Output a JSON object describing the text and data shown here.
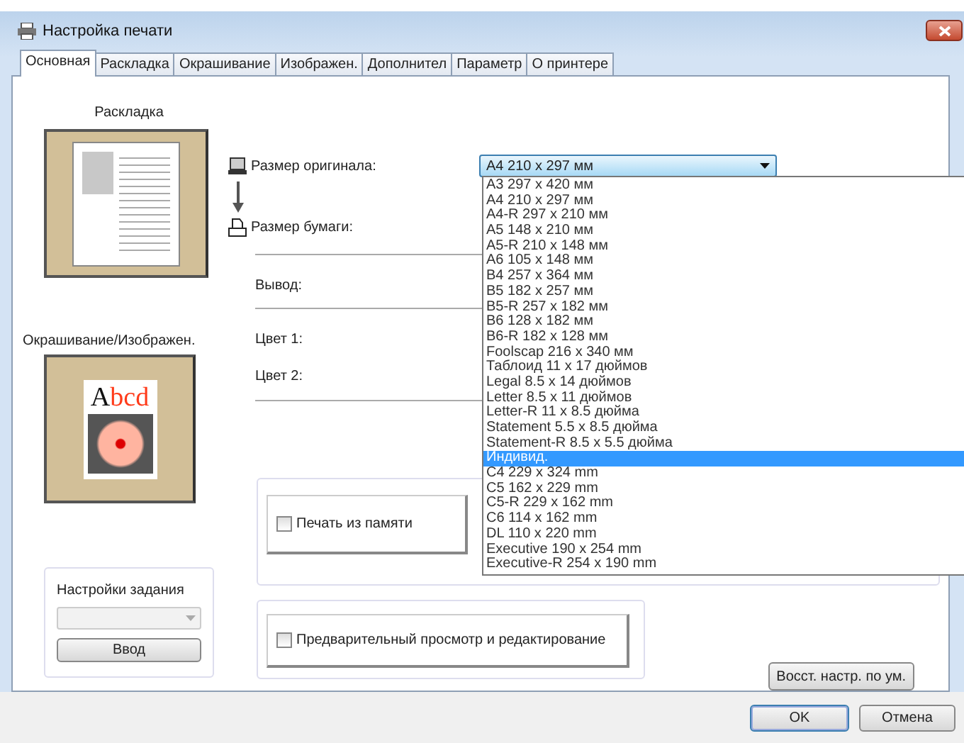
{
  "window": {
    "title": "Настройка печати"
  },
  "tabs": [
    {
      "label": "Основная",
      "selected": true
    },
    {
      "label": "Раскладка",
      "selected": false
    },
    {
      "label": "Окрашивание",
      "selected": false
    },
    {
      "label": "Изображен.",
      "selected": false
    },
    {
      "label": "Дополнител",
      "selected": false
    },
    {
      "label": "Параметр",
      "selected": false
    },
    {
      "label": "О принтере",
      "selected": false
    }
  ],
  "left_panel": {
    "layout_label": "Раскладка",
    "color_label": "Окрашивание/Изображен.",
    "sample_text": "Abcd",
    "job_settings": {
      "title": "Настройки задания",
      "button": "Ввод"
    }
  },
  "settings": {
    "original_size_label": "Размер оригинала:",
    "original_size_value": "A4 210 x 297 мм",
    "paper_size_label": "Размер бумаги:",
    "output_label": "Вывод:",
    "color1_label": "Цвет 1:",
    "color2_label": "Цвет 2:"
  },
  "size_options": [
    {
      "label": "A3 297 x 420 мм",
      "selected": false
    },
    {
      "label": "A4 210 x 297 мм",
      "selected": false
    },
    {
      "label": "A4-R 297 x 210 мм",
      "selected": false
    },
    {
      "label": "A5 148 x 210 мм",
      "selected": false
    },
    {
      "label": "A5-R 210 x 148 мм",
      "selected": false
    },
    {
      "label": "A6 105 x 148 мм",
      "selected": false
    },
    {
      "label": "B4 257 x 364 мм",
      "selected": false
    },
    {
      "label": "B5 182 x 257 мм",
      "selected": false
    },
    {
      "label": "B5-R 257 x 182 мм",
      "selected": false
    },
    {
      "label": "B6 128 x 182 мм",
      "selected": false
    },
    {
      "label": "B6-R 182 x 128 мм",
      "selected": false
    },
    {
      "label": "Foolscap 216 x 340 мм",
      "selected": false
    },
    {
      "label": "Таблоид 11 x 17 дюймов",
      "selected": false
    },
    {
      "label": "Legal 8.5 x 14 дюймов",
      "selected": false
    },
    {
      "label": "Letter 8.5 x 11 дюймов",
      "selected": false
    },
    {
      "label": "Letter-R 11 x 8.5 дюйма",
      "selected": false
    },
    {
      "label": "Statement 5.5 x 8.5 дюйма",
      "selected": false
    },
    {
      "label": "Statement-R 8.5 x 5.5 дюйма",
      "selected": false
    },
    {
      "label": "Индивид.",
      "selected": true
    },
    {
      "label": "C4 229 x 324 mm",
      "selected": false
    },
    {
      "label": "C5 162 x 229 mm",
      "selected": false
    },
    {
      "label": "C5-R 229 x 162 mm",
      "selected": false
    },
    {
      "label": "C6 114 x 162 mm",
      "selected": false
    },
    {
      "label": "DL 110 x 220 mm",
      "selected": false
    },
    {
      "label": "Executive 190 x 254 mm",
      "selected": false
    },
    {
      "label": "Executive-R 254 x 190 mm",
      "selected": false
    }
  ],
  "memory_print": {
    "label": "Печать из памяти",
    "checked": false
  },
  "preview_edit": {
    "label": "Предварительный просмотр и редактирование",
    "checked": false
  },
  "restore_button": "Восст. настр. по ум.",
  "buttons": [
    {
      "label": "OK",
      "default": true
    },
    {
      "label": "Отмена",
      "default": false
    }
  ]
}
